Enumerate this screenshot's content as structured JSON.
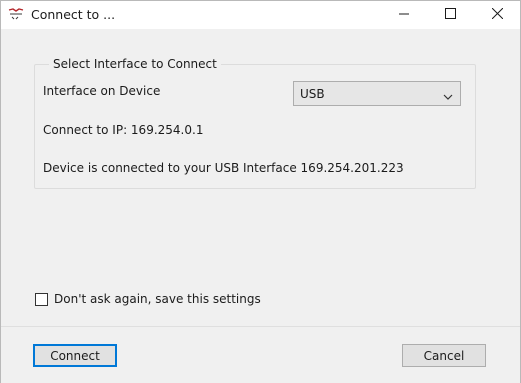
{
  "window": {
    "title": "Connect to ...",
    "icon": "app-logo-icon",
    "controls": {
      "minimize": "minimize-icon",
      "maximize": "maximize-icon",
      "close": "close-icon"
    }
  },
  "group": {
    "legend": "Select Interface to Connect",
    "interface_label": "Interface on Device",
    "interface_select": {
      "value": "USB"
    },
    "ip_text": "Connect to IP: 169.254.0.1",
    "status_text": "Device is connected to your USB Interface 169.254.201.223"
  },
  "dont_ask": {
    "label": "Don't ask again, save this settings",
    "checked": false
  },
  "footer": {
    "connect_label": "Connect",
    "cancel_label": "Cancel"
  },
  "colors": {
    "accent": "#0078d7",
    "window_bg": "#f0f0f0",
    "titlebar_bg": "#ffffff"
  }
}
